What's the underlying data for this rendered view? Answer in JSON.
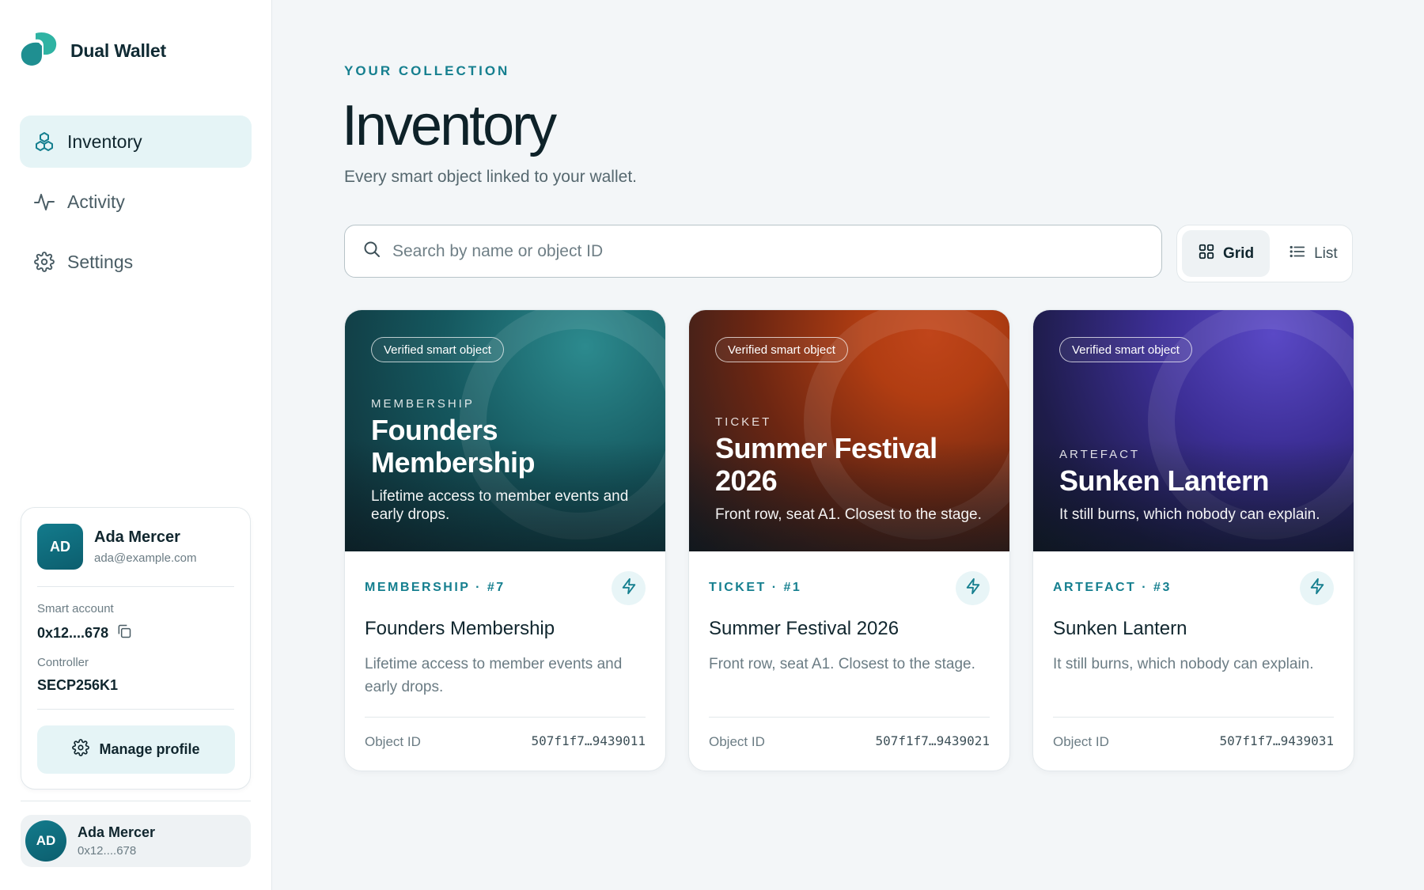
{
  "brand": {
    "name": "Dual Wallet",
    "color": "#2fb3a3"
  },
  "nav": [
    {
      "label": "Inventory",
      "icon": "cubes-icon",
      "active": true
    },
    {
      "label": "Activity",
      "icon": "activity-icon",
      "active": false
    },
    {
      "label": "Settings",
      "icon": "gear-icon",
      "active": false
    }
  ],
  "profile": {
    "initials": "AD",
    "name": "Ada Mercer",
    "email": "ada@example.com",
    "smart_account_label": "Smart account",
    "smart_account": "0x12....678",
    "controller_label": "Controller",
    "controller": "SECP256K1",
    "manage_label": "Manage profile"
  },
  "footer_user": {
    "initials": "AD",
    "name": "Ada Mercer",
    "address": "0x12....678"
  },
  "header": {
    "eyebrow": "YOUR COLLECTION",
    "title": "Inventory",
    "subtitle": "Every smart object linked to your wallet."
  },
  "search": {
    "placeholder": "Search by name or object ID",
    "value": ""
  },
  "view_toggle": {
    "grid_label": "Grid",
    "list_label": "List",
    "selected": "Grid"
  },
  "cards": [
    {
      "theme": "teal",
      "badge": "Verified smart object",
      "category": "MEMBERSHIP",
      "title": "Founders Membership",
      "description": "Lifetime access to member events and early drops.",
      "tag": "MEMBERSHIP · #7",
      "object_id_label": "Object ID",
      "object_id": "507f1f7…9439011"
    },
    {
      "theme": "orange",
      "badge": "Verified smart object",
      "category": "TICKET",
      "title": "Summer Festival 2026",
      "description": "Front row, seat A1. Closest to the stage.",
      "tag": "TICKET · #1",
      "object_id_label": "Object ID",
      "object_id": "507f1f7…9439021"
    },
    {
      "theme": "indigo",
      "badge": "Verified smart object",
      "category": "ARTEFACT",
      "title": "Sunken Lantern",
      "description": "It still burns, which nobody can explain.",
      "tag": "ARTEFACT · #3",
      "object_id_label": "Object ID",
      "object_id": "507f1f7…9439031"
    }
  ],
  "colors": {
    "accent": "#157f8f",
    "active_nav_bg": "#e5f4f6",
    "page_bg": "#f3f6f8"
  }
}
